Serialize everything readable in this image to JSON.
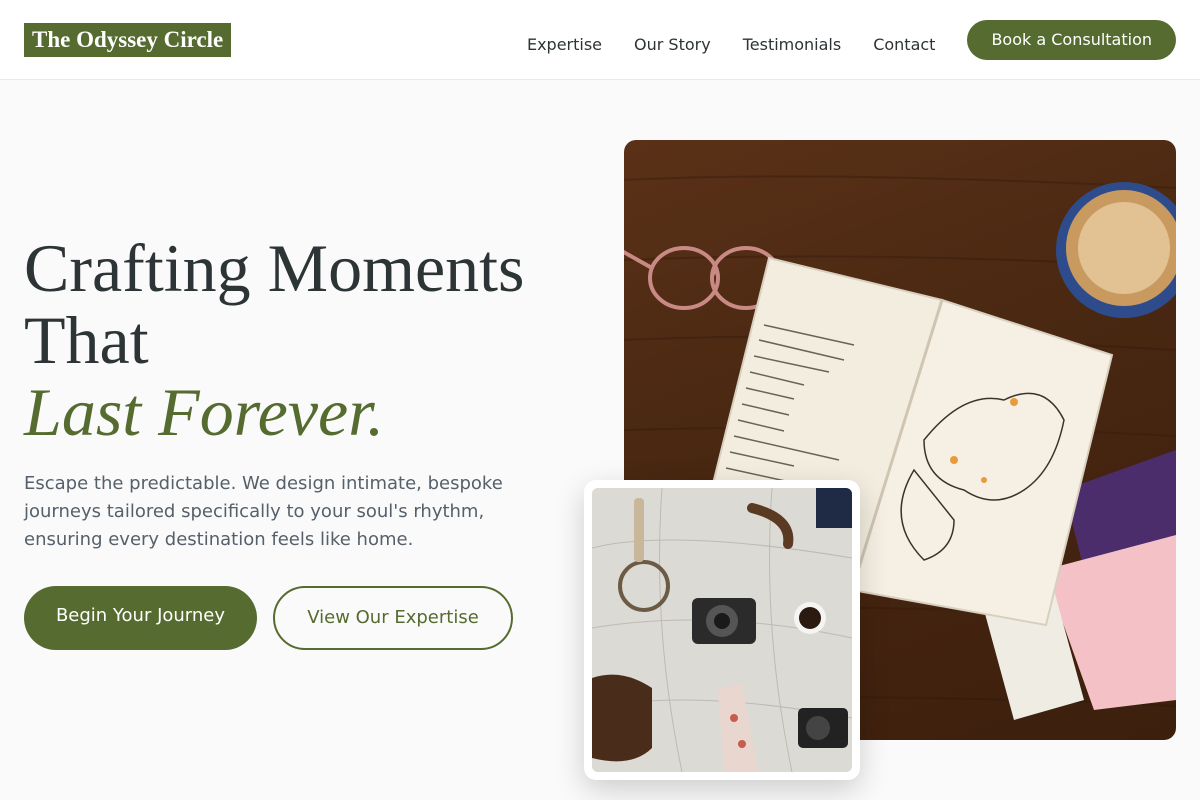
{
  "brand": {
    "name": "The Odyssey Circle"
  },
  "nav": {
    "items": [
      {
        "label": "Expertise"
      },
      {
        "label": "Our Story"
      },
      {
        "label": "Testimonials"
      },
      {
        "label": "Contact"
      }
    ],
    "cta_label": "Book a Consultation"
  },
  "hero": {
    "title_line1": "Crafting Moments",
    "title_line2": "That",
    "title_accent": "Last Forever.",
    "subtitle": "Escape the predictable. We design intimate, bespoke journeys tailored specifically to your soul's rhythm, ensuring every destination feels like home.",
    "primary_button": "Begin Your Journey",
    "secondary_button": "View Our Expertise"
  },
  "images": {
    "main": {
      "icon": "travel-journal-photo"
    },
    "inset": {
      "icon": "vintage-cameras-map-photo"
    }
  },
  "colors": {
    "accent": "#556b2f",
    "text": "#2d3436",
    "muted_text": "#56606a",
    "background": "#fafafa"
  }
}
